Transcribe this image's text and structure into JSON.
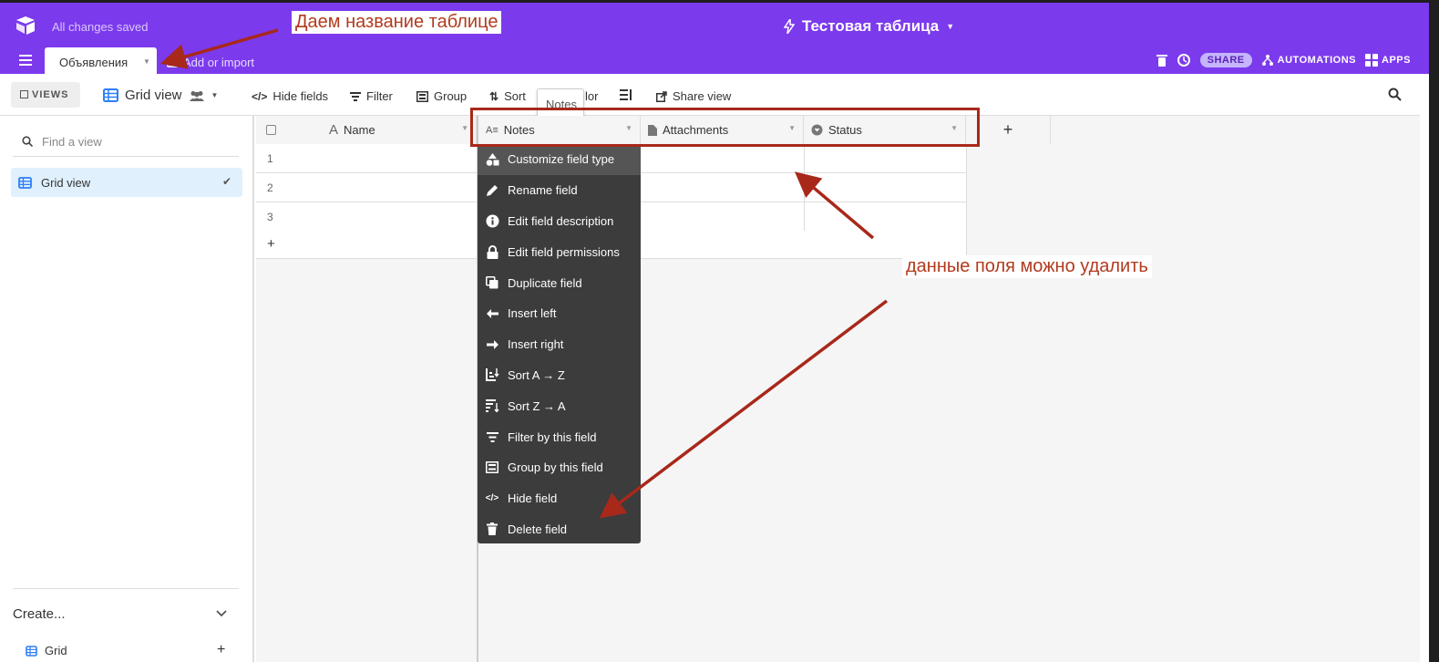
{
  "header": {
    "saved_status": "All changes saved",
    "base_name": "Тестовая таблица",
    "table_tab": "Объявления",
    "add_import": "Add or import",
    "share": "SHARE",
    "automations": "AUTOMATIONS",
    "apps": "APPS"
  },
  "toolbar": {
    "views": "VIEWS",
    "view_name": "Grid view",
    "hide_fields": "Hide fields",
    "filter": "Filter",
    "group": "Group",
    "sort": "Sort",
    "color": "lor",
    "share_view": "Share view",
    "tooltip": "Notes"
  },
  "sidebar": {
    "find_placeholder": "Find a view",
    "views": [
      {
        "label": "Grid view",
        "active": true
      }
    ],
    "create": "Create...",
    "create_items": [
      {
        "label": "Grid"
      }
    ]
  },
  "grid": {
    "columns": [
      {
        "label": "Name"
      },
      {
        "label": "Notes"
      },
      {
        "label": "Attachments"
      },
      {
        "label": "Status"
      }
    ],
    "rows": [
      "1",
      "2",
      "3"
    ],
    "add_row": "+",
    "add_column": "+"
  },
  "field_menu": {
    "items": [
      {
        "label": "Customize field type",
        "icon": "shapes-icon"
      },
      {
        "label": "Rename field",
        "icon": "pencil-icon"
      },
      {
        "label": "Edit field description",
        "icon": "info-icon"
      },
      {
        "label": "Edit field permissions",
        "icon": "lock-icon"
      },
      {
        "label": "Duplicate field",
        "icon": "duplicate-icon"
      },
      {
        "label": "Insert left",
        "icon": "arrow-left-icon"
      },
      {
        "label": "Insert right",
        "icon": "arrow-right-icon"
      },
      {
        "label": "Sort A → Z",
        "icon": "sort-asc-icon"
      },
      {
        "label": "Sort Z → A",
        "icon": "sort-desc-icon"
      },
      {
        "label": "Filter by this field",
        "icon": "filter-icon"
      },
      {
        "label": "Group by this field",
        "icon": "group-icon"
      },
      {
        "label": "Hide field",
        "icon": "eye-off-icon"
      },
      {
        "label": "Delete field",
        "icon": "trash-icon"
      }
    ]
  },
  "annotations": {
    "name_table": "Даем название таблице",
    "can_delete": "данные поля можно удалить"
  },
  "colors": {
    "brand": "#7c3aed",
    "annotation": "#b23a1e",
    "menu_bg": "#3c3c3c"
  }
}
